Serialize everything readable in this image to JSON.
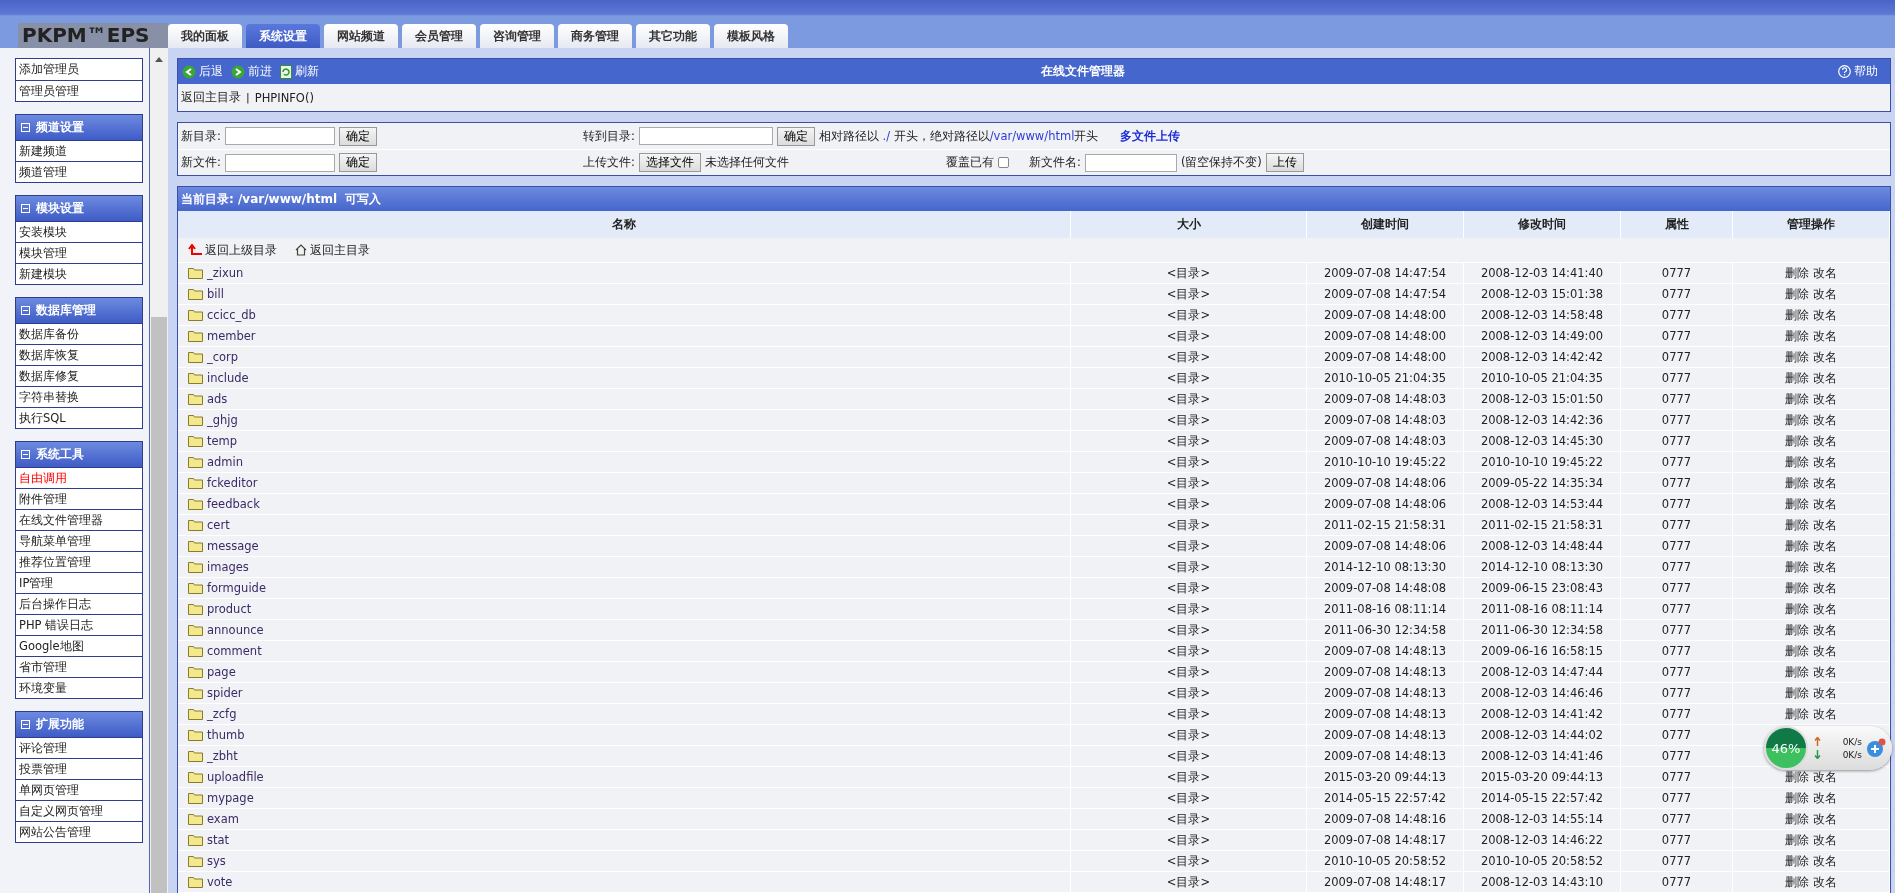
{
  "logo": "PKPM™EPS",
  "tabs": [
    {
      "label": "我的面板",
      "selected": false
    },
    {
      "label": "系统设置",
      "selected": true
    },
    {
      "label": "网站频道",
      "selected": false
    },
    {
      "label": "会员管理",
      "selected": false
    },
    {
      "label": "咨询管理",
      "selected": false
    },
    {
      "label": "商务管理",
      "selected": false
    },
    {
      "label": "其它功能",
      "selected": false
    },
    {
      "label": "模板风格",
      "selected": false
    }
  ],
  "sidebar": {
    "groups": [
      {
        "items": [
          {
            "label": "添加管理员",
            "selected": false
          },
          {
            "label": "管理员管理",
            "selected": false
          }
        ]
      },
      {
        "title": "频道设置",
        "items": [
          {
            "label": "新建频道",
            "selected": false
          },
          {
            "label": "频道管理",
            "selected": false
          }
        ]
      },
      {
        "title": "模块设置",
        "items": [
          {
            "label": "安装模块",
            "selected": false
          },
          {
            "label": "模块管理",
            "selected": false
          },
          {
            "label": "新建模块",
            "selected": false
          }
        ]
      },
      {
        "title": "数据库管理",
        "items": [
          {
            "label": "数据库备份",
            "selected": false
          },
          {
            "label": "数据库恢复",
            "selected": false
          },
          {
            "label": "数据库修复",
            "selected": false
          },
          {
            "label": "字符串替换",
            "selected": false
          },
          {
            "label": "执行SQL",
            "selected": false
          }
        ]
      },
      {
        "title": "系统工具",
        "items": [
          {
            "label": "自由调用",
            "selected": true
          },
          {
            "label": "附件管理",
            "selected": false
          },
          {
            "label": "在线文件管理器",
            "selected": false
          },
          {
            "label": "导航菜单管理",
            "selected": false
          },
          {
            "label": "推荐位置管理",
            "selected": false
          },
          {
            "label": "IP管理",
            "selected": false
          },
          {
            "label": "后台操作日志",
            "selected": false
          },
          {
            "label": "PHP 错误日志",
            "selected": false
          },
          {
            "label": "Google地图",
            "selected": false
          },
          {
            "label": "省市管理",
            "selected": false
          },
          {
            "label": "环境变量",
            "selected": false
          }
        ]
      },
      {
        "title": "扩展功能",
        "items": [
          {
            "label": "评论管理",
            "selected": false
          },
          {
            "label": "投票管理",
            "selected": false
          },
          {
            "label": "单网页管理",
            "selected": false
          },
          {
            "label": "自定义网页管理",
            "selected": false
          },
          {
            "label": "网站公告管理",
            "selected": false
          }
        ]
      }
    ]
  },
  "toolbar": {
    "buttons": [
      {
        "label": "后退",
        "kind": "back"
      },
      {
        "label": "前进",
        "kind": "forward"
      },
      {
        "label": "刷新",
        "kind": "refresh"
      }
    ],
    "title": "在线文件管理器",
    "help": "帮助"
  },
  "links": [
    "返回主目录",
    "PHPINFO()"
  ],
  "link_separator": "|",
  "form": {
    "new_dir": {
      "label": "新目录:",
      "button": "确定"
    },
    "goto_dir": {
      "label": "转到目录:",
      "button": "确定",
      "hint": [
        {
          "text": "相对路径以 ",
          "kind": "plain"
        },
        {
          "text": "./",
          "kind": "path"
        },
        {
          "text": " 开头，绝对路径以",
          "kind": "plain"
        },
        {
          "text": "/var/www/html",
          "kind": "path"
        },
        {
          "text": "开头",
          "kind": "plain"
        }
      ],
      "multi_upload": "多文件上传"
    },
    "new_file": {
      "label": "新文件:",
      "button": "确定"
    },
    "upload": {
      "label": "上传文件:",
      "choose": "选择文件",
      "status": "未选择任何文件",
      "overwrite_label": "覆盖已有",
      "overwrite": false,
      "name_label": "新文件名:",
      "name_hint": "(留空保持不变)",
      "button": "上传"
    }
  },
  "listing": {
    "title": "当前目录: /var/www/html  可写入",
    "columns": [
      "名称",
      "大小",
      "创建时间",
      "修改时间",
      "属性",
      "管理操作"
    ],
    "up": "返回上级目录",
    "home": "返回主目录",
    "rows": [
      {
        "name": "_zixun",
        "size": "<目录>",
        "created": "2009-07-08 14:47:54",
        "modified": "2008-12-03 14:41:40",
        "mode": "0777",
        "actions": [
          "删除",
          "改名"
        ]
      },
      {
        "name": "bill",
        "size": "<目录>",
        "created": "2009-07-08 14:47:54",
        "modified": "2008-12-03 15:01:38",
        "mode": "0777",
        "actions": [
          "删除",
          "改名"
        ]
      },
      {
        "name": "ccicc_db",
        "size": "<目录>",
        "created": "2009-07-08 14:48:00",
        "modified": "2008-12-03 14:58:48",
        "mode": "0777",
        "actions": [
          "删除",
          "改名"
        ]
      },
      {
        "name": "member",
        "size": "<目录>",
        "created": "2009-07-08 14:48:00",
        "modified": "2008-12-03 14:49:00",
        "mode": "0777",
        "actions": [
          "删除",
          "改名"
        ]
      },
      {
        "name": "_corp",
        "size": "<目录>",
        "created": "2009-07-08 14:48:00",
        "modified": "2008-12-03 14:42:42",
        "mode": "0777",
        "actions": [
          "删除",
          "改名"
        ]
      },
      {
        "name": "include",
        "size": "<目录>",
        "created": "2010-10-05 21:04:35",
        "modified": "2010-10-05 21:04:35",
        "mode": "0777",
        "actions": [
          "删除",
          "改名"
        ]
      },
      {
        "name": "ads",
        "size": "<目录>",
        "created": "2009-07-08 14:48:03",
        "modified": "2008-12-03 15:01:50",
        "mode": "0777",
        "actions": [
          "删除",
          "改名"
        ]
      },
      {
        "name": "_ghjg",
        "size": "<目录>",
        "created": "2009-07-08 14:48:03",
        "modified": "2008-12-03 14:42:36",
        "mode": "0777",
        "actions": [
          "删除",
          "改名"
        ]
      },
      {
        "name": "temp",
        "size": "<目录>",
        "created": "2009-07-08 14:48:03",
        "modified": "2008-12-03 14:45:30",
        "mode": "0777",
        "actions": [
          "删除",
          "改名"
        ]
      },
      {
        "name": "admin",
        "size": "<目录>",
        "created": "2010-10-10 19:45:22",
        "modified": "2010-10-10 19:45:22",
        "mode": "0777",
        "actions": [
          "删除",
          "改名"
        ]
      },
      {
        "name": "fckeditor",
        "size": "<目录>",
        "created": "2009-07-08 14:48:06",
        "modified": "2009-05-22 14:35:34",
        "mode": "0777",
        "actions": [
          "删除",
          "改名"
        ]
      },
      {
        "name": "feedback",
        "size": "<目录>",
        "created": "2009-07-08 14:48:06",
        "modified": "2008-12-03 14:53:44",
        "mode": "0777",
        "actions": [
          "删除",
          "改名"
        ]
      },
      {
        "name": "cert",
        "size": "<目录>",
        "created": "2011-02-15 21:58:31",
        "modified": "2011-02-15 21:58:31",
        "mode": "0777",
        "actions": [
          "删除",
          "改名"
        ]
      },
      {
        "name": "message",
        "size": "<目录>",
        "created": "2009-07-08 14:48:06",
        "modified": "2008-12-03 14:48:44",
        "mode": "0777",
        "actions": [
          "删除",
          "改名"
        ]
      },
      {
        "name": "images",
        "size": "<目录>",
        "created": "2014-12-10 08:13:30",
        "modified": "2014-12-10 08:13:30",
        "mode": "0777",
        "actions": [
          "删除",
          "改名"
        ]
      },
      {
        "name": "formguide",
        "size": "<目录>",
        "created": "2009-07-08 14:48:08",
        "modified": "2009-06-15 23:08:43",
        "mode": "0777",
        "actions": [
          "删除",
          "改名"
        ]
      },
      {
        "name": "product",
        "size": "<目录>",
        "created": "2011-08-16 08:11:14",
        "modified": "2011-08-16 08:11:14",
        "mode": "0777",
        "actions": [
          "删除",
          "改名"
        ]
      },
      {
        "name": "announce",
        "size": "<目录>",
        "created": "2011-06-30 12:34:58",
        "modified": "2011-06-30 12:34:58",
        "mode": "0777",
        "actions": [
          "删除",
          "改名"
        ]
      },
      {
        "name": "comment",
        "size": "<目录>",
        "created": "2009-07-08 14:48:13",
        "modified": "2009-06-16 16:58:15",
        "mode": "0777",
        "actions": [
          "删除",
          "改名"
        ]
      },
      {
        "name": "page",
        "size": "<目录>",
        "created": "2009-07-08 14:48:13",
        "modified": "2008-12-03 14:47:44",
        "mode": "0777",
        "actions": [
          "删除",
          "改名"
        ]
      },
      {
        "name": "spider",
        "size": "<目录>",
        "created": "2009-07-08 14:48:13",
        "modified": "2008-12-03 14:46:46",
        "mode": "0777",
        "actions": [
          "删除",
          "改名"
        ]
      },
      {
        "name": "_zcfg",
        "size": "<目录>",
        "created": "2009-07-08 14:48:13",
        "modified": "2008-12-03 14:41:42",
        "mode": "0777",
        "actions": [
          "删除",
          "改名"
        ]
      },
      {
        "name": "thumb",
        "size": "<目录>",
        "created": "2009-07-08 14:48:13",
        "modified": "2008-12-03 14:44:02",
        "mode": "0777"
      },
      {
        "name": "_zbht",
        "size": "<目录>",
        "created": "2009-07-08 14:48:13",
        "modified": "2008-12-03 14:41:46",
        "mode": "0777"
      },
      {
        "name": "uploadfile",
        "size": "<目录>",
        "created": "2015-03-20 09:44:13",
        "modified": "2015-03-20 09:44:13",
        "mode": "0777",
        "actions": [
          "删除",
          "改名"
        ]
      },
      {
        "name": "mypage",
        "size": "<目录>",
        "created": "2014-05-15 22:57:42",
        "modified": "2014-05-15 22:57:42",
        "mode": "0777",
        "actions": [
          "删除",
          "改名"
        ]
      },
      {
        "name": "exam",
        "size": "<目录>",
        "created": "2009-07-08 14:48:16",
        "modified": "2008-12-03 14:55:14",
        "mode": "0777",
        "actions": [
          "删除",
          "改名"
        ]
      },
      {
        "name": "stat",
        "size": "<目录>",
        "created": "2009-07-08 14:48:17",
        "modified": "2008-12-03 14:46:22",
        "mode": "0777",
        "actions": [
          "删除",
          "改名"
        ]
      },
      {
        "name": "sys",
        "size": "<目录>",
        "created": "2010-10-05 20:58:52",
        "modified": "2010-10-05 20:58:52",
        "mode": "0777",
        "actions": [
          "删除",
          "改名"
        ]
      },
      {
        "name": "vote",
        "size": "<目录>",
        "created": "2009-07-08 14:48:17",
        "modified": "2008-12-03 14:43:10",
        "mode": "0777",
        "actions": [
          "删除",
          "改名"
        ]
      }
    ]
  },
  "widget": {
    "load": "46%",
    "upload": "0K/s",
    "download": "0K/s"
  }
}
